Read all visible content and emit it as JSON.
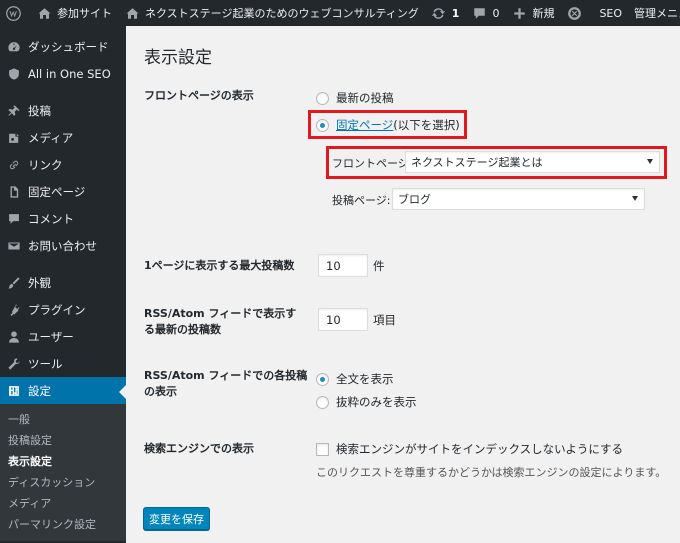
{
  "adminbar": {
    "site_name": "参加サイト",
    "home_title": "ネクストステージ起業のためのウェブコンサルティング",
    "updates_count": "1",
    "comments_count": "0",
    "new_label": "新規",
    "seo_label": "SEO",
    "admin_menu_label": "管理メニュー"
  },
  "sidebar": {
    "items": [
      {
        "label": "ダッシュボード",
        "icon": "dashboard-icon"
      },
      {
        "label": "All in One SEO",
        "icon": "shield-icon"
      },
      {
        "label": "投稿",
        "icon": "pin-icon"
      },
      {
        "label": "メディア",
        "icon": "media-icon"
      },
      {
        "label": "リンク",
        "icon": "link-icon"
      },
      {
        "label": "固定ページ",
        "icon": "page-icon"
      },
      {
        "label": "コメント",
        "icon": "comment-icon"
      },
      {
        "label": "お問い合わせ",
        "icon": "mail-icon"
      },
      {
        "label": "外観",
        "icon": "brush-icon"
      },
      {
        "label": "プラグイン",
        "icon": "plugin-icon"
      },
      {
        "label": "ユーザー",
        "icon": "user-icon"
      },
      {
        "label": "ツール",
        "icon": "wrench-icon"
      },
      {
        "label": "設定",
        "icon": "settings-icon"
      }
    ],
    "submenu": [
      "一般",
      "投稿設定",
      "表示設定",
      "ディスカッション",
      "メディア",
      "パーマリンク設定"
    ]
  },
  "main": {
    "title": "表示設定",
    "front_page": {
      "label": "フロントページの表示",
      "option_latest": "最新の投稿",
      "option_static_link": "固定ページ",
      "option_static_suffix": " (以下を選択)",
      "front_select_label": "フロントページ:",
      "front_select_value": "ネクストステージ起業とは",
      "posts_select_label": "投稿ページ:",
      "posts_select_value": "ブログ"
    },
    "posts_per_page": {
      "label": "1ページに表示する最大投稿数",
      "value": "10",
      "unit": "件"
    },
    "rss_count": {
      "label": "RSS/Atom フィードで表示する最新の投稿数",
      "value": "10",
      "unit": "項目"
    },
    "rss_display": {
      "label": "RSS/Atom フィードでの各投稿の表示",
      "option_full": "全文を表示",
      "option_summary": "抜粋のみを表示"
    },
    "search_engine": {
      "label": "検索エンジンでの表示",
      "checkbox_label": "検索エンジンがサイトをインデックスしないようにする",
      "description": "このリクエストを尊重するかどうかは検索エンジンの設定によります。"
    },
    "save_label": "変更を保存"
  },
  "colors": {
    "admin_dark": "#23282d",
    "accent_blue": "#0073aa",
    "highlight_red": "#e1191f",
    "background": "#f1f1f1"
  }
}
